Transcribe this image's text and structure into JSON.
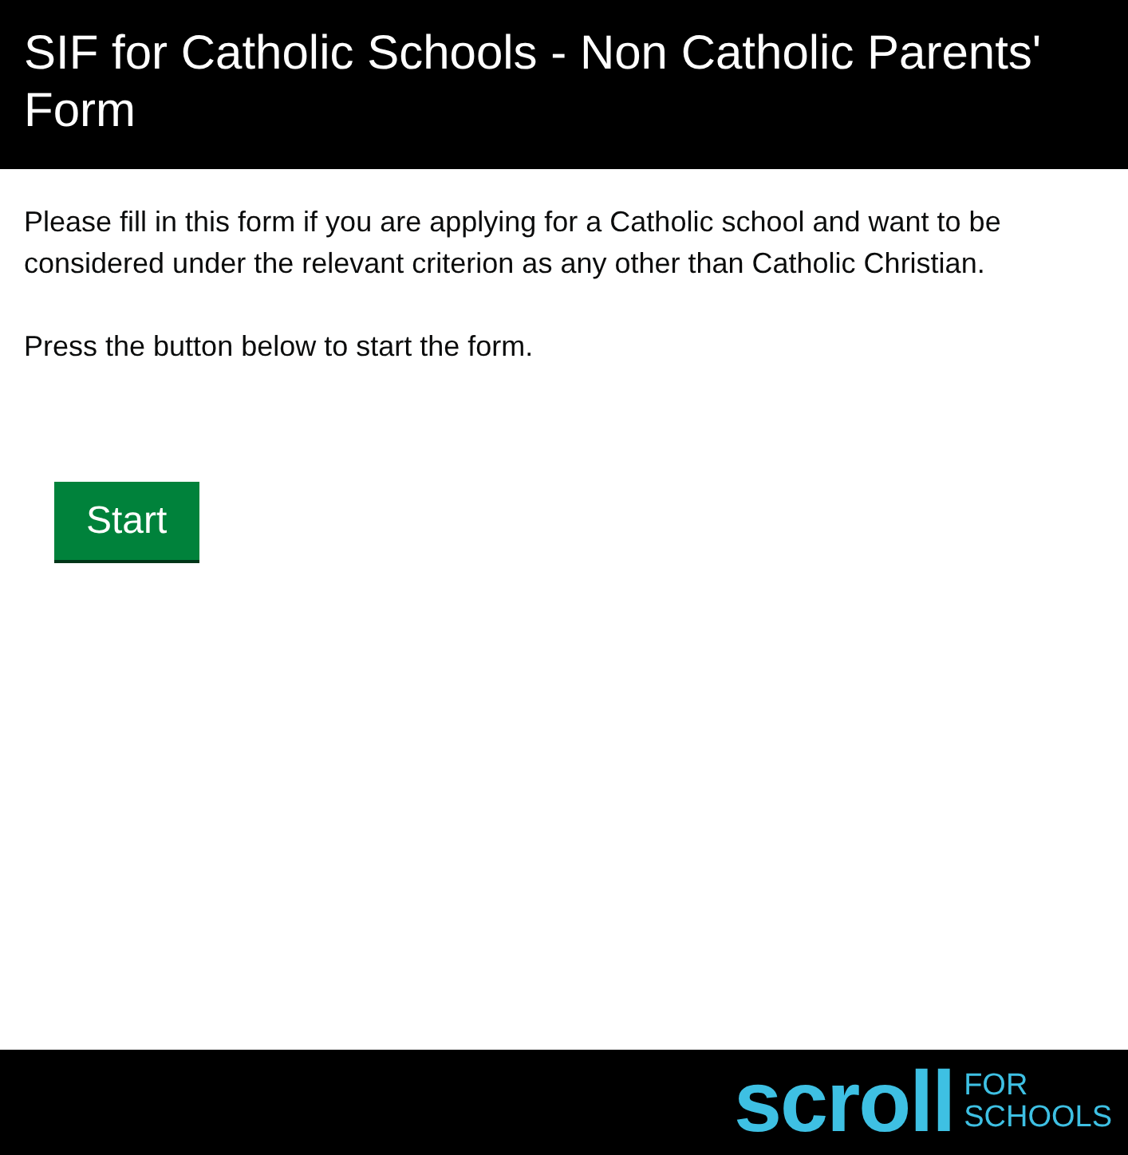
{
  "header": {
    "title": "SIF for Catholic Schools - Non Catholic Parents' Form"
  },
  "paragraphs": [
    "Please fill in this form if you are applying for a Catholic school and want to be considered under the relevant criterion as any other than Catholic Christian.",
    "Press the button below to start the form."
  ],
  "start_button": {
    "label": "Start"
  },
  "footer": {
    "logo": {
      "wordmark": "scroll",
      "tagline_top": "FOR",
      "tagline_bottom": "SCHOOLS"
    }
  }
}
